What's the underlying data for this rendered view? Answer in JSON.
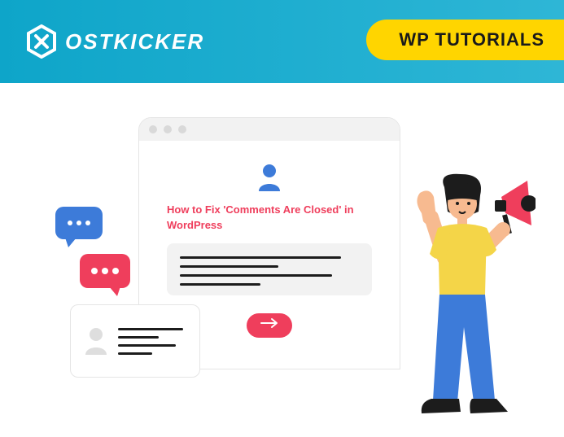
{
  "header": {
    "brand_text": "OSTKICKER",
    "badge_label": "WP TUTORIALS"
  },
  "main_window": {
    "heading": "How to Fix 'Comments Are Closed' in WordPress"
  },
  "icons": {
    "user": "user-icon",
    "arrow": "arrow-right-icon",
    "megaphone": "megaphone-icon"
  },
  "colors": {
    "accent_red": "#ef3e5c",
    "accent_blue": "#3d7bd9",
    "badge_yellow": "#ffd500"
  }
}
